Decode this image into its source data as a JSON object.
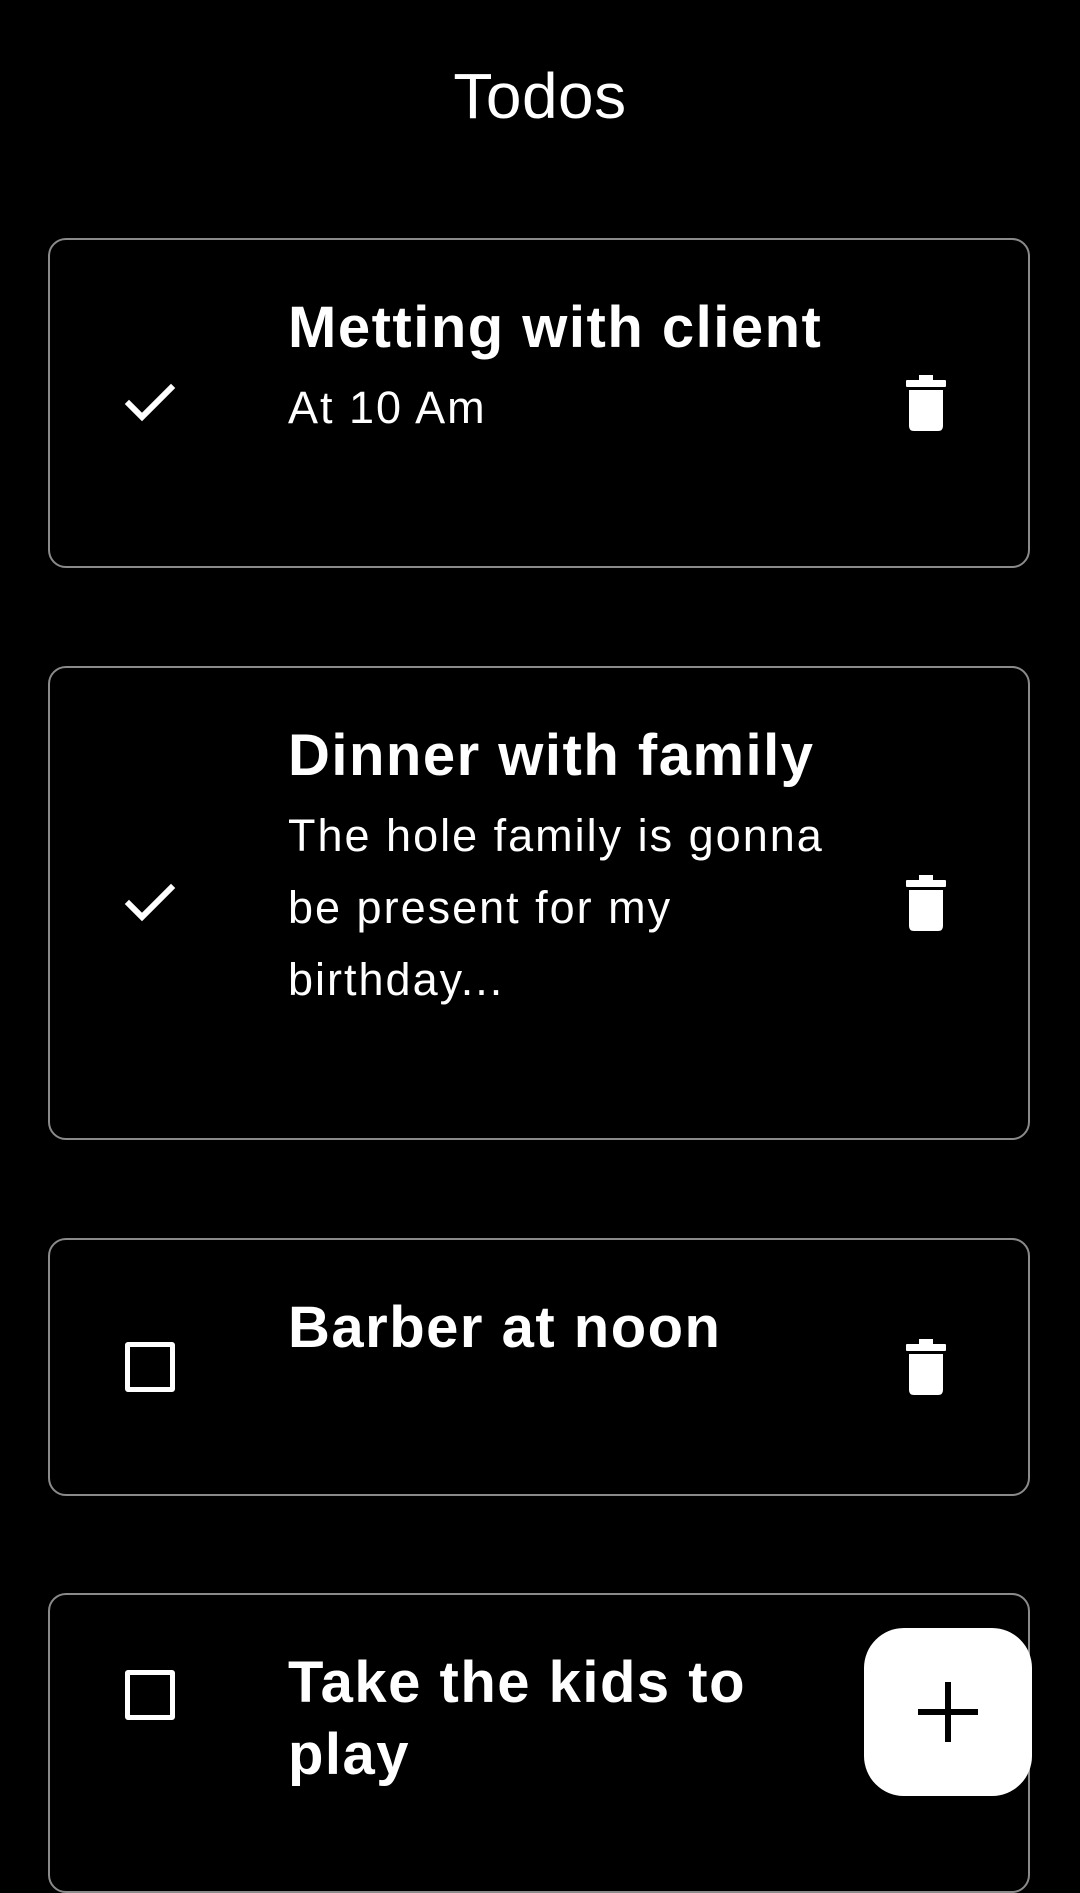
{
  "app": {
    "title": "Todos"
  },
  "todos": [
    {
      "title": "Metting with client",
      "description": "At 10 Am",
      "completed": true,
      "check_icon": "check-icon",
      "delete_icon": "trash-icon"
    },
    {
      "title": "Dinner with family",
      "description": "The hole family is gonna be present for my birthday...",
      "completed": true,
      "check_icon": "check-icon",
      "delete_icon": "trash-icon"
    },
    {
      "title": "Barber at noon",
      "description": "",
      "completed": false,
      "check_icon": "checkbox-empty-icon",
      "delete_icon": "trash-icon"
    },
    {
      "title": "Take the kids to play",
      "description": "",
      "completed": false,
      "check_icon": "checkbox-empty-icon",
      "delete_icon": "trash-icon"
    }
  ],
  "fab": {
    "icon": "plus-icon"
  },
  "colors": {
    "background": "#000000",
    "text": "#ffffff",
    "card_border": "#8a8a8a",
    "fab_background": "#ffffff",
    "fab_icon": "#000000"
  }
}
